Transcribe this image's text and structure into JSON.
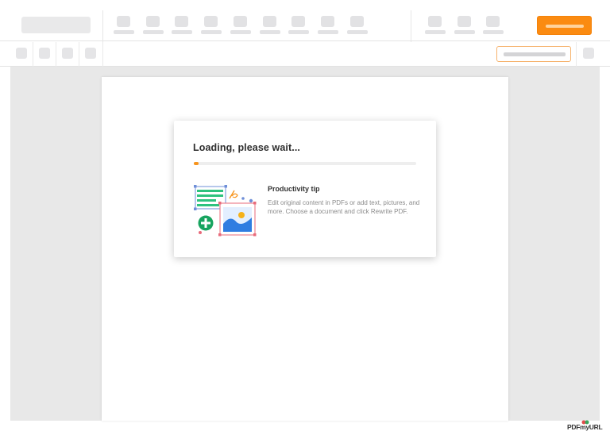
{
  "dialog": {
    "title": "Loading, please wait...",
    "progress": 0.02,
    "tip_title": "Productivity tip",
    "tip_body": "Edit original content in PDFs or add text, pictures, and more. Choose a document and click Rewrite PDF."
  },
  "watermark": {
    "text": "PDFmyURL"
  },
  "colors": {
    "accent": "#fb8b11",
    "progress": "#f7941d",
    "workspace_bg": "#e8e8e8",
    "placeholder": "#e2e2e4"
  },
  "icons": [
    "document-text-icon",
    "pen-icon",
    "image-icon",
    "add-circle-icon",
    "sun-icon"
  ]
}
